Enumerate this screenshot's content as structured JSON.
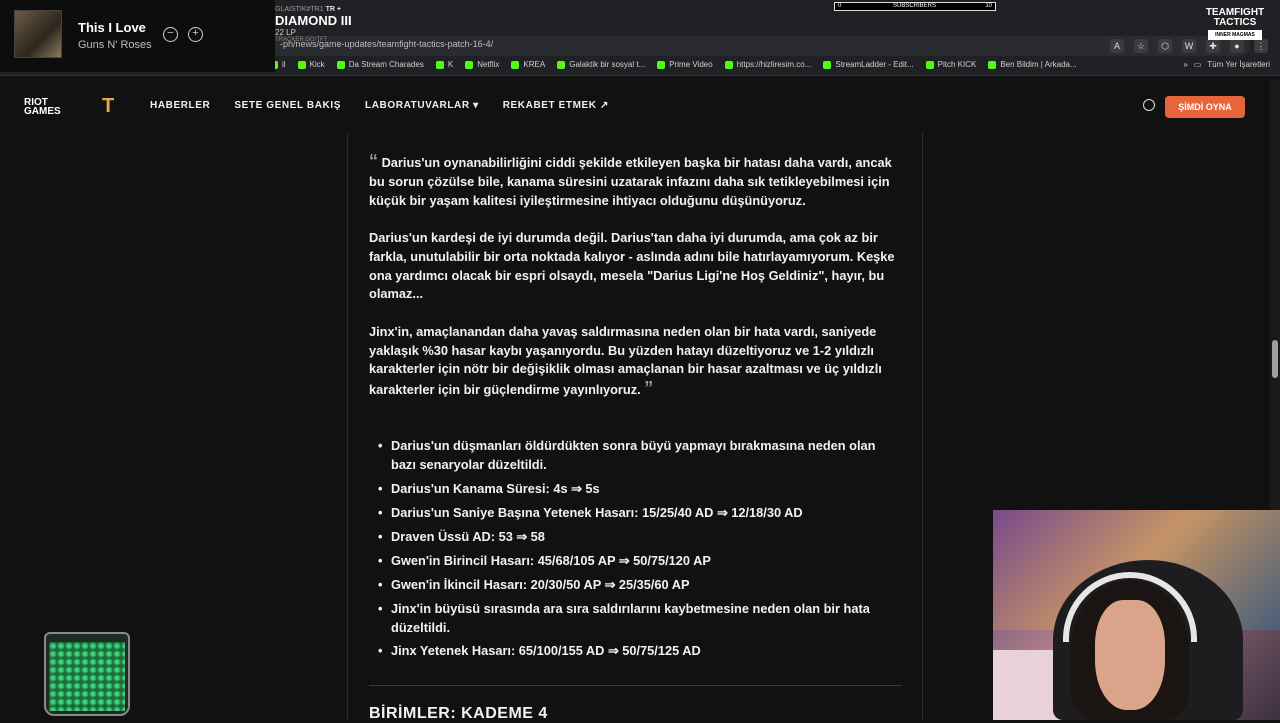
{
  "music": {
    "title": "This I Love",
    "artist": "Guns N' Roses",
    "minus_symbol": "−",
    "plus_symbol": "+"
  },
  "rank_overlay": {
    "name_prefix": "GLAISTIK#TR1",
    "name_suffix": "TR +",
    "rank": "DIAMOND III",
    "lp": "22 LP",
    "site": "TRACKER.GG/TFT"
  },
  "subscribers": {
    "current": "0",
    "label": "SUBSCRIBERS",
    "goal": "10"
  },
  "tft_corner_logo": {
    "line1": "TEAMFIGHT",
    "line2": "TACTICS",
    "tag": "INNER MAGMAS"
  },
  "browser": {
    "url": "-ph/news/game-updates/teamfight-tactics-patch-16-4/",
    "bookmarks": [
      {
        "label": "il"
      },
      {
        "label": "Kick"
      },
      {
        "label": "Da Stream Charades"
      },
      {
        "label": "K"
      },
      {
        "label": "Netflix"
      },
      {
        "label": "KREA"
      },
      {
        "label": "Galaktik bir sosyal t..."
      },
      {
        "label": "Prime Video"
      },
      {
        "label": "https://hizliresim.co..."
      },
      {
        "label": "StreamLadder - Edit..."
      },
      {
        "label": "Pitch KICK"
      },
      {
        "label": "Ben Bildim | Arkada..."
      }
    ],
    "all_bookmarks": "Tüm Yer İşaretleri",
    "overflow": "»"
  },
  "site_nav": {
    "riot_line1": "RIOT",
    "riot_line2": "GAMES",
    "tft_mark": "T",
    "links": [
      "HABERLER",
      "SETE GENEL BAKIŞ",
      "LABORATUVARLAR ▾",
      "REKABET ETMEK ↗"
    ],
    "play_now": "ŞİMDİ OYNA"
  },
  "article": {
    "open_quote": "“",
    "close_quote": "”",
    "paragraphs": [
      "Darius'un oynanabilirliğini ciddi şekilde etkileyen başka bir hatası daha vardı, ancak bu sorun çözülse bile, kanama süresini uzatarak infazını daha sık tetikleyebilmesi için küçük bir yaşam kalitesi iyileştirmesine ihtiyacı olduğunu düşünüyoruz.",
      "Darius'un kardeşi de iyi durumda değil. Darius'tan daha iyi durumda, ama çok az bir farkla, unutulabilir bir orta noktada kalıyor - aslında adını bile hatırlayamıyorum. Keşke ona yardımcı olacak bir espri olsaydı, mesela \"Darius Ligi'ne Hoş Geldiniz\", hayır, bu olamaz...",
      "Jinx'in, amaçlanandan daha yavaş saldırmasına neden olan bir hata vardı, saniyede yaklaşık %30 hasar kaybı yaşanıyordu. Bu yüzden hatayı düzeltiyoruz ve 1-2 yıldızlı karakterler için nötr bir değişiklik olması amaçlanan bir hasar azaltması ve üç yıldızlı karakterler için bir güçlendirme yayınlıyoruz."
    ],
    "bullets": [
      "Darius'un düşmanları öldürdükten sonra büyü yapmayı bırakmasına neden olan bazı senaryolar düzeltildi.",
      "Darius'un Kanama Süresi: 4s ⇒ 5s",
      "Darius'un Saniye Başına Yetenek Hasarı: 15/25/40 AD ⇒ 12/18/30 AD",
      "Draven Üssü AD: 53 ⇒ 58",
      "Gwen'in Birincil Hasarı: 45/68/105 AP ⇒ 50/75/120 AP",
      "Gwen'in İkincil Hasarı: 20/30/50 AP ⇒ 25/35/60 AP",
      "Jinx'in büyüsü sırasında ara sıra saldırılarını kaybetmesine neden olan bir hata düzeltildi.",
      "Jinx Yetenek Hasarı: 65/100/155 AD ⇒ 50/75/125 AD"
    ],
    "next_heading": "BİRİMLER: KADEME 4"
  }
}
